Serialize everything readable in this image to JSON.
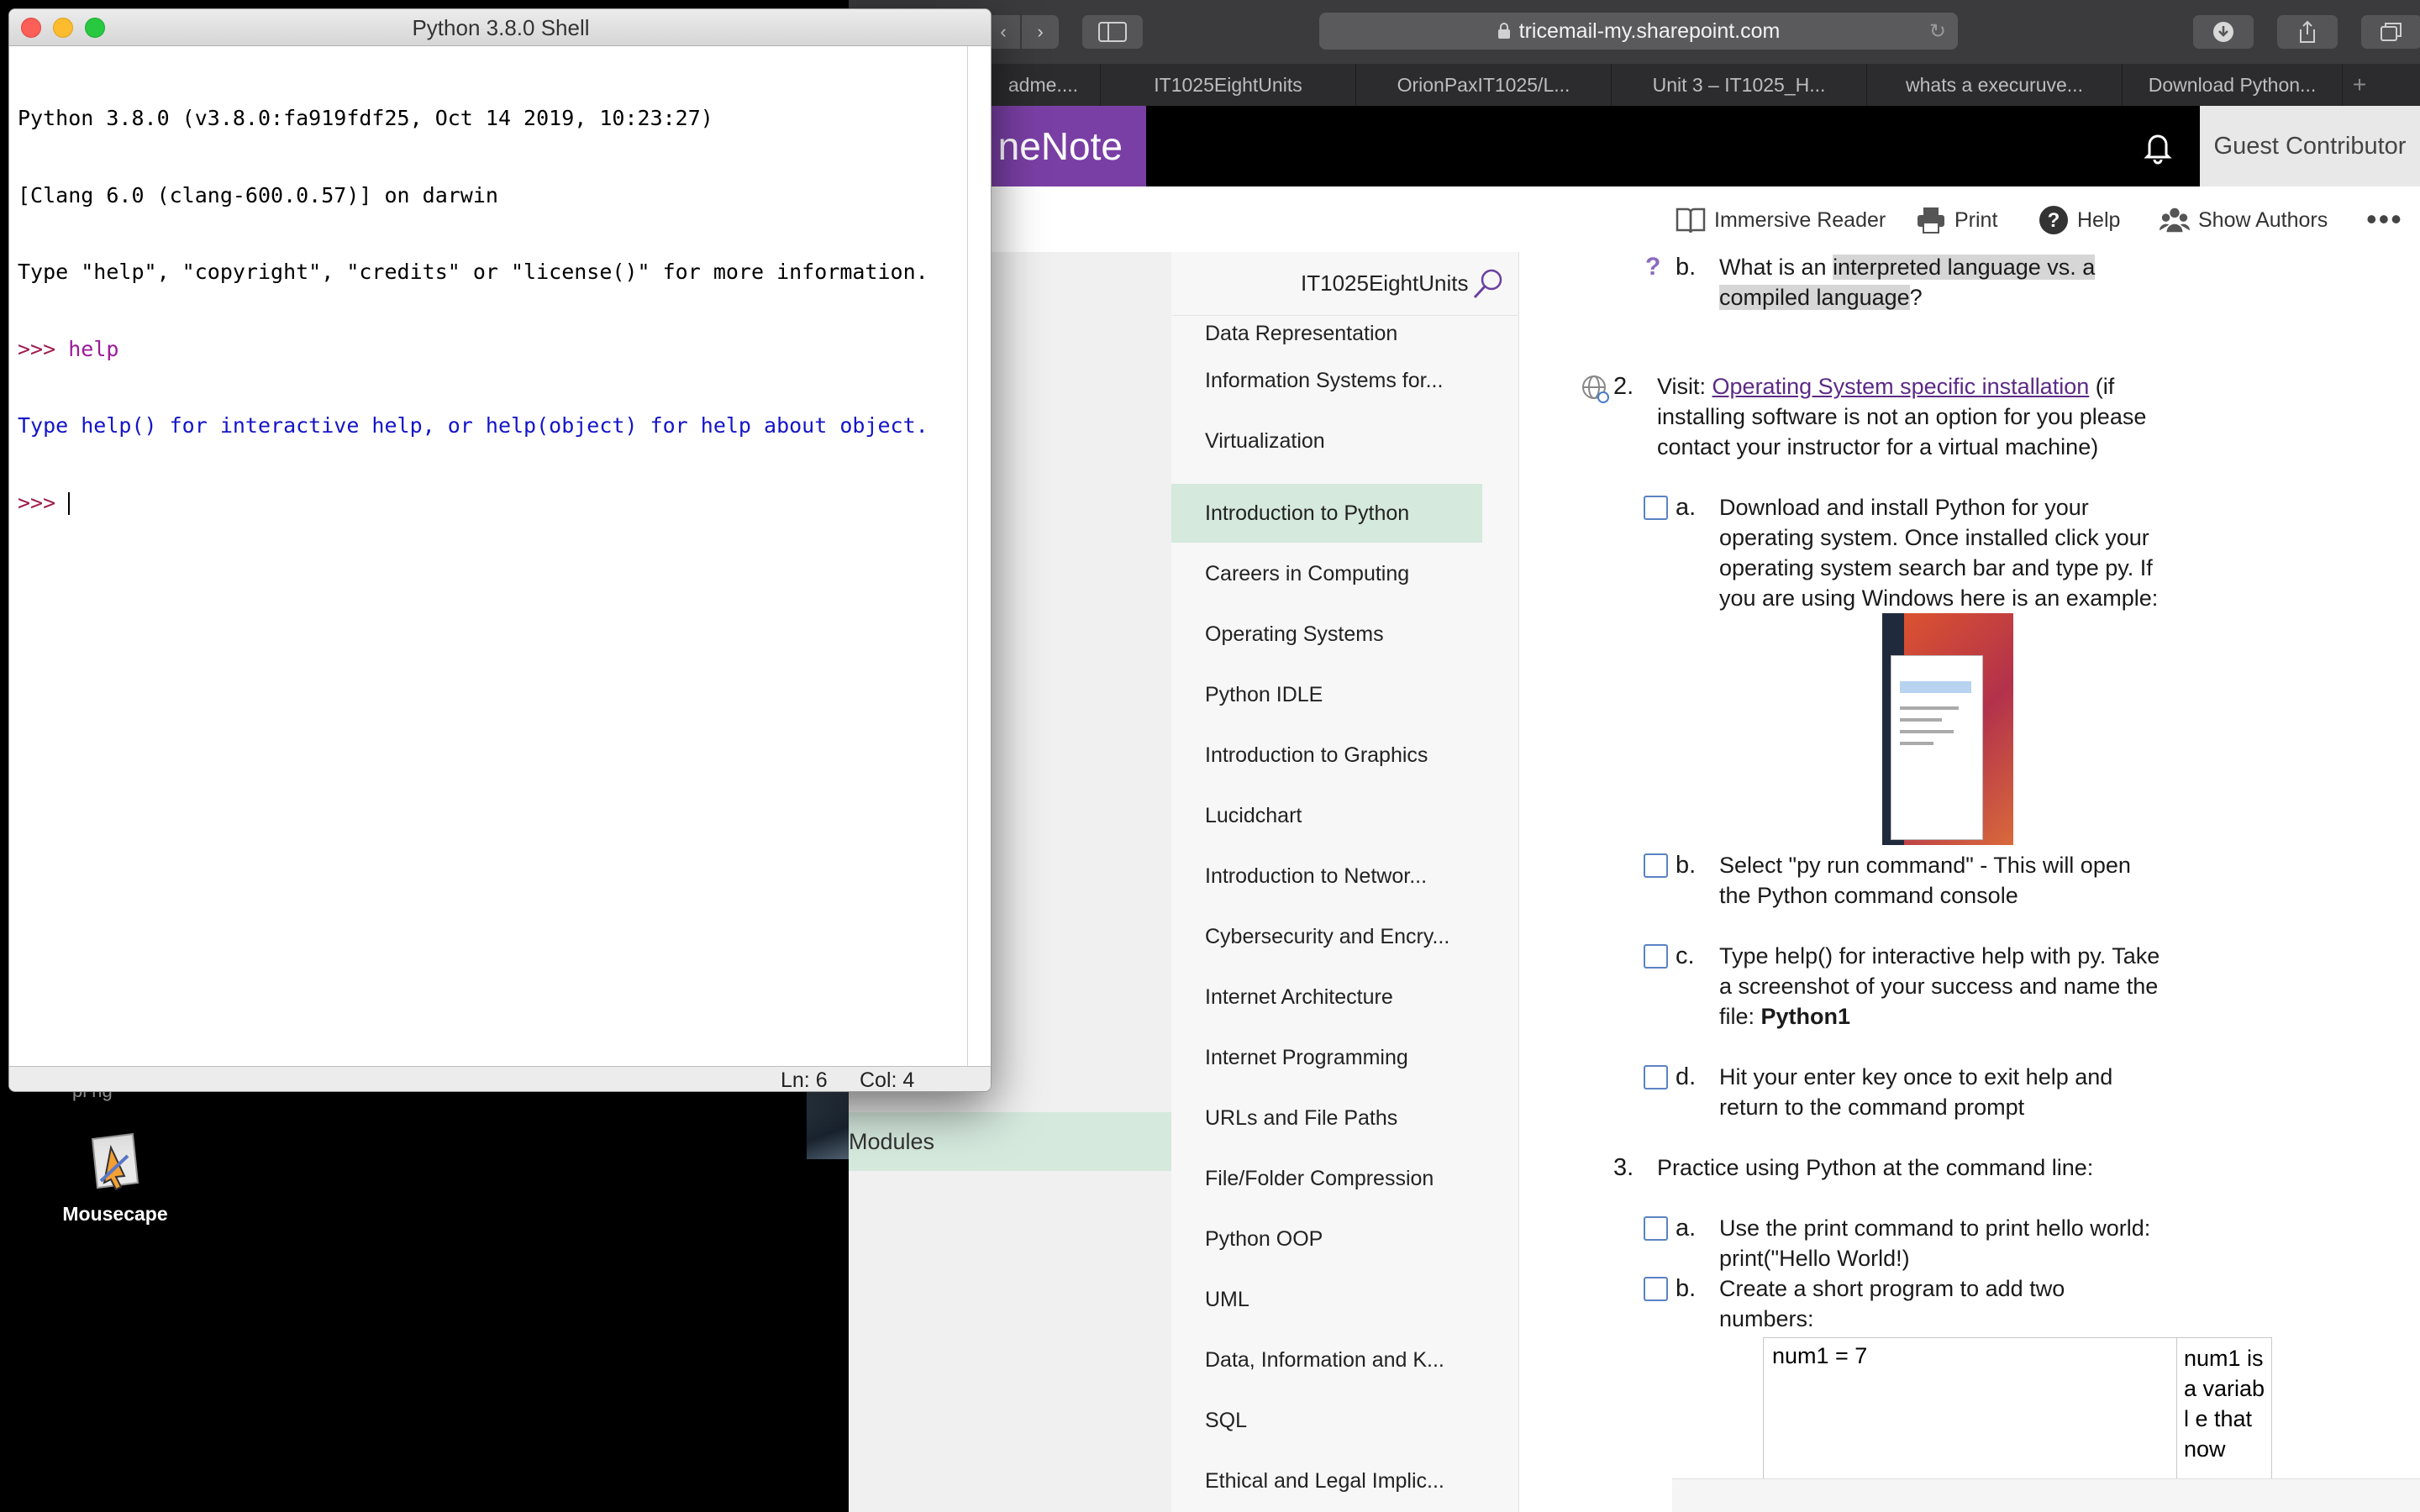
{
  "desktop": {
    "icon_label": "Mousecape",
    "partial_label": "pl ng"
  },
  "safari": {
    "address": "tricemail-my.sharepoint.com",
    "tabs": [
      "adme....",
      "IT1025EightUnits",
      "OrionPaxIT1025/L...",
      "Unit 3 – IT1025_H...",
      "whats a execuruve...",
      "Download Python..."
    ],
    "new_tab": "+"
  },
  "onenote": {
    "brand": "neNote",
    "user": "Guest Contributor",
    "ribbon": {
      "immersive_reader": "Immersive Reader",
      "print": "Print",
      "help": "Help",
      "show_authors": "Show Authors",
      "more": "•••"
    },
    "notebook_title": "IT1025EightUnits",
    "section_group": "Modules",
    "sections": [
      "Data Representation",
      "Information Systems for...",
      "Virtualization",
      "Introduction to Python",
      "Careers in Computing",
      "Operating Systems",
      "Python IDLE",
      "Introduction to Graphics",
      "Lucidchart",
      "Introduction to Networ...",
      "Cybersecurity and Encry...",
      "Internet Architecture",
      "Internet Programming",
      "URLs and File Paths",
      "File/Folder Compression",
      "Python OOP",
      "UML",
      "Data, Information and K...",
      "SQL",
      "Ethical and Legal Implic..."
    ],
    "selected_section": "Introduction to Python",
    "page": {
      "b_top_letter": "b.",
      "b_top_prefix": "What is an ",
      "b_top_hl": "interpreted language vs. a",
      "b_top_line2_hl": "compiled language",
      "b_top_line2_end": "?",
      "q2_num": "2.",
      "q2_visit": "Visit: ",
      "q2_link": "Operating System specific installation",
      "q2_rest1": " (if",
      "q2_line2": "installing software is not an option for you please",
      "q2_line3": "contact your instructor for a virtual machine)",
      "a_letter": "a.",
      "a_lines": [
        "Download and install Python for your",
        "operating system.  Once installed click your",
        "operating system search bar and type py.  If",
        "you are using Windows here is an example:"
      ],
      "b_letter": "b.",
      "b_lines": [
        "Select \"py run command\" - This will open",
        "the Python command console"
      ],
      "c_letter": "c.",
      "c_lines": [
        "Type help() for interactive help with py. Take",
        "a screenshot of your success and name the"
      ],
      "c_file_prefix": "file: ",
      "c_file_name": "Python1",
      "d_letter": "d.",
      "d_lines": [
        "Hit your enter key once to exit help and",
        "return to the command prompt"
      ],
      "q3_num": "3.",
      "q3_text": "Practice using Python at the command line:",
      "q3a_letter": "a.",
      "q3a_lines": [
        "Use the print command to print hello world:",
        "print(\"Hello World!)"
      ],
      "q3b_letter": "b.",
      "q3b_lines": [
        "Create a short program to add two",
        "numbers:"
      ],
      "table_code": "num1 = 7",
      "table_note": "num1 is a variabl e that now"
    }
  },
  "idle": {
    "title": "Python 3.8.0 Shell",
    "banner_1": "Python 3.8.0 (v3.8.0:fa919fdf25, Oct 14 2019, 10:23:27)",
    "banner_2": "[Clang 6.0 (clang-600.0.57)] on darwin",
    "banner_3": "Type \"help\", \"copyright\", \"credits\" or \"license()\" for more information.",
    "prompt": ">>> ",
    "input_1": "help",
    "output_1": "Type help() for interactive help, or help(object) for help about object.",
    "status_ln": "Ln: 6",
    "status_col": "Col: 4"
  }
}
